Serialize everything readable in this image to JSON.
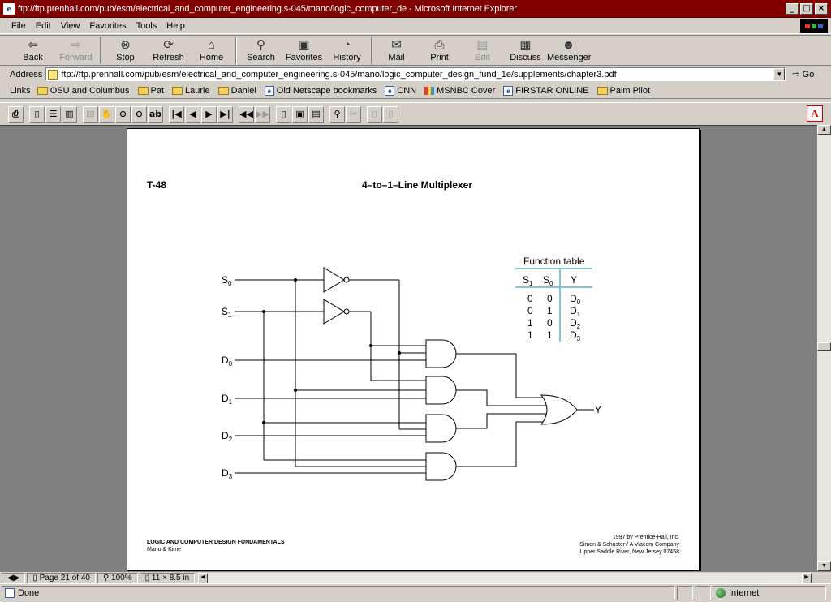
{
  "window": {
    "title": "ftp://ftp.prenhall.com/pub/esm/electrical_and_computer_engineering.s-045/mano/logic_computer_de - Microsoft Internet Explorer",
    "controls": [
      "_",
      "□",
      "×"
    ]
  },
  "menu": {
    "items": [
      {
        "label": "File"
      },
      {
        "label": "Edit"
      },
      {
        "label": "View"
      },
      {
        "label": "Favorites"
      },
      {
        "label": "Tools"
      },
      {
        "label": "Help"
      }
    ]
  },
  "toolbar": {
    "buttons": [
      {
        "label": "Back",
        "icon": "back-arrow-icon",
        "glyph": "⇦",
        "enabled": true
      },
      {
        "label": "Forward",
        "icon": "forward-arrow-icon",
        "glyph": "⇨",
        "enabled": false
      },
      {
        "label": "Stop",
        "icon": "stop-icon",
        "glyph": "⊗",
        "enabled": true
      },
      {
        "label": "Refresh",
        "icon": "refresh-icon",
        "glyph": "⟳",
        "enabled": true
      },
      {
        "label": "Home",
        "icon": "home-icon",
        "glyph": "⌂",
        "enabled": true
      },
      {
        "label": "Search",
        "icon": "search-icon",
        "glyph": "⚲",
        "enabled": true
      },
      {
        "label": "Favorites",
        "icon": "favorites-icon",
        "glyph": "▣",
        "enabled": true
      },
      {
        "label": "History",
        "icon": "history-icon",
        "glyph": "◔",
        "enabled": true
      },
      {
        "label": "Mail",
        "icon": "mail-icon",
        "glyph": "✉",
        "enabled": true
      },
      {
        "label": "Print",
        "icon": "print-icon",
        "glyph": "⎙",
        "enabled": true
      },
      {
        "label": "Edit",
        "icon": "edit-icon",
        "glyph": "▤",
        "enabled": false
      },
      {
        "label": "Discuss",
        "icon": "discuss-icon",
        "glyph": "▦",
        "enabled": true
      },
      {
        "label": "Messenger",
        "icon": "messenger-icon",
        "glyph": "☻",
        "enabled": true
      }
    ]
  },
  "address": {
    "label": "Address",
    "url": "ftp://ftp.prenhall.com/pub/esm/electrical_and_computer_engineering.s-045/mano/logic_computer_design_fund_1e/supplements/chapter3.pdf",
    "go_label": "Go"
  },
  "links": {
    "label": "Links",
    "items": [
      {
        "label": "OSU and Columbus",
        "icon": "folder"
      },
      {
        "label": "Pat",
        "icon": "folder"
      },
      {
        "label": "Laurie",
        "icon": "folder"
      },
      {
        "label": "Daniel",
        "icon": "folder"
      },
      {
        "label": "Old Netscape bookmarks",
        "icon": "ie"
      },
      {
        "label": "CNN",
        "icon": "ie"
      },
      {
        "label": "MSNBC Cover",
        "icon": "msnbc"
      },
      {
        "label": "FIRSTAR ONLINE",
        "icon": "ie"
      },
      {
        "label": "Palm Pilot",
        "icon": "folder"
      }
    ]
  },
  "document": {
    "tag": "T-48",
    "title": "4–to–1–Line Multiplexer",
    "inputs": {
      "s0": "S",
      "s0_sub": "0",
      "s1": "S",
      "s1_sub": "1",
      "d0": "D",
      "d0_sub": "0",
      "d1": "D",
      "d1_sub": "1",
      "d2": "D",
      "d2_sub": "2",
      "d3": "D",
      "d3_sub": "3"
    },
    "output": "Y",
    "function_table": {
      "title": "Function table",
      "headers": [
        {
          "base": "S",
          "sub": "1"
        },
        {
          "base": "S",
          "sub": "0"
        },
        {
          "base": "Y",
          "sub": ""
        }
      ],
      "rows": [
        {
          "s1": "0",
          "s0": "0",
          "y": "D",
          "ysub": "0"
        },
        {
          "s1": "0",
          "s0": "1",
          "y": "D",
          "ysub": "1"
        },
        {
          "s1": "1",
          "s0": "0",
          "y": "D",
          "ysub": "2"
        },
        {
          "s1": "1",
          "s0": "1",
          "y": "D",
          "ysub": "3"
        }
      ]
    },
    "footer_left": {
      "line1": "LOGIC AND COMPUTER DESIGN FUNDAMENTALS",
      "line2": "Mano & Kime"
    },
    "footer_right": {
      "line1": "1997 by Prentice-Hall, Inc.",
      "line2": "Simon & Schuster / A Viacom Company",
      "line3": "Upper Saddle River, New Jersey 07458"
    }
  },
  "pdf_status": {
    "page": "Page 21 of 40",
    "zoom": "100%",
    "size": "11 × 8.5 in"
  },
  "status": {
    "text": "Done",
    "zone": "Internet"
  },
  "colors": {
    "title_bar": "#800000",
    "table_rule": "#5bb0c8"
  }
}
